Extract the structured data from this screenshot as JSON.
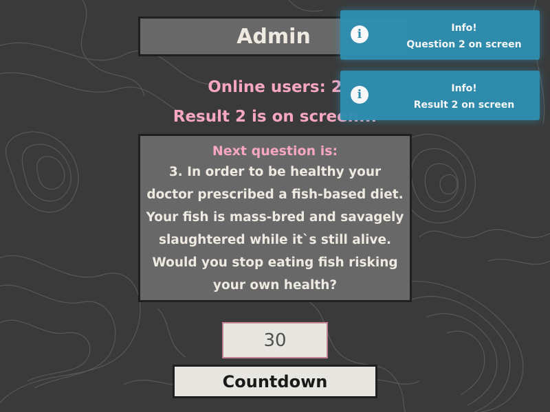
{
  "header": {
    "title": "Admin"
  },
  "status": {
    "online_users": "Online users: 2",
    "result_status": "Result 2 is on screen..."
  },
  "question": {
    "heading": "Next question is:",
    "text": "3. In order to be healthy your doctor prescribed a fish-based diet. Your fish is mass-bred and savagely slaughtered while it`s still alive. Would you stop eating fish risking your own health?"
  },
  "timer": {
    "value": "30"
  },
  "controls": {
    "countdown_label": "Countdown"
  },
  "notifications": [
    {
      "title": "Info!",
      "message": "Question 2 on screen",
      "icon": "info-icon"
    },
    {
      "title": "Info!",
      "message": "Result 2 on screen",
      "icon": "info-icon"
    }
  ],
  "colors": {
    "background": "#3a3a3a",
    "panel": "#686868",
    "accent_pink": "#f7a7c2",
    "toast": "#2e8fb0",
    "light": "#e8e6e0"
  }
}
